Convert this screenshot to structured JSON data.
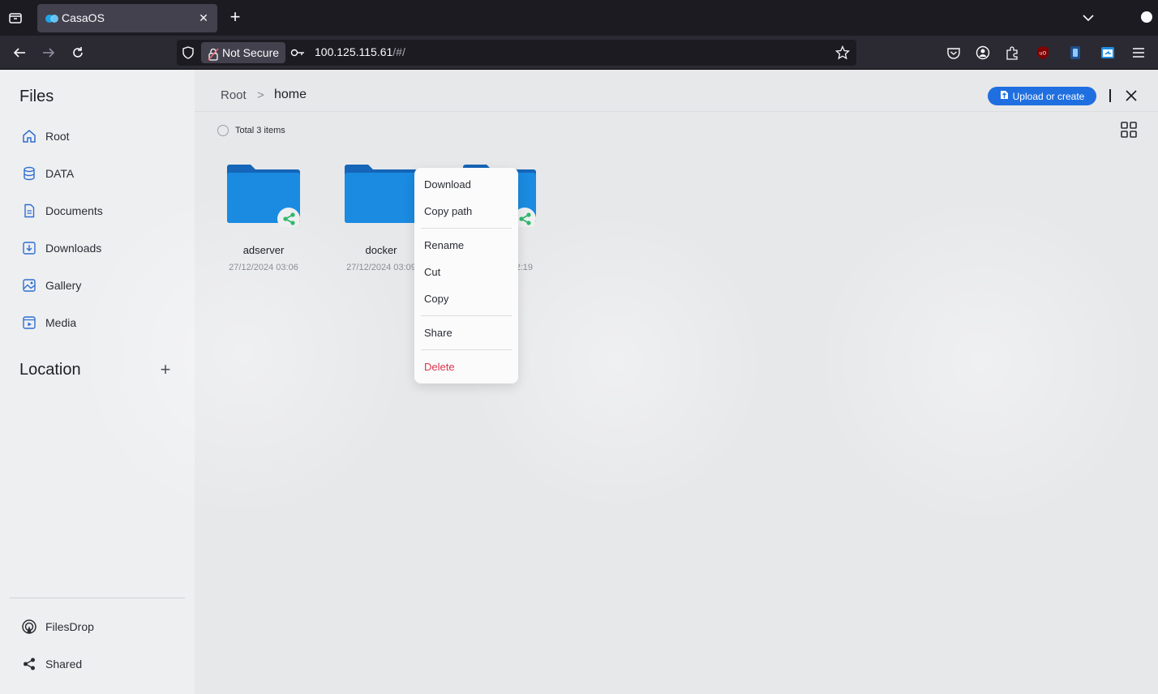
{
  "browser": {
    "tab_title": "CasaOS",
    "security_label": "Not Secure",
    "url_host": "100.125.115.61",
    "url_path": "/#/"
  },
  "sidebar": {
    "title": "Files",
    "items": [
      {
        "label": "Root",
        "icon": "home-icon"
      },
      {
        "label": "DATA",
        "icon": "database-icon"
      },
      {
        "label": "Documents",
        "icon": "document-icon"
      },
      {
        "label": "Downloads",
        "icon": "download-icon"
      },
      {
        "label": "Gallery",
        "icon": "image-icon"
      },
      {
        "label": "Media",
        "icon": "media-icon"
      }
    ],
    "location_title": "Location",
    "location_add": "+",
    "bottom_items": [
      {
        "label": "FilesDrop",
        "icon": "filesdrop-icon"
      },
      {
        "label": "Shared",
        "icon": "share-icon"
      }
    ]
  },
  "main": {
    "breadcrumb": [
      "Root",
      "home"
    ],
    "breadcrumb_sep": ">",
    "upload_label": "Upload or create",
    "total_label": "Total 3 items",
    "folders": [
      {
        "name": "adserver",
        "date": "27/12/2024 03:06",
        "shared": true
      },
      {
        "name": "docker",
        "date": "27/12/2024 03:09",
        "shared": false
      },
      {
        "name": "",
        "date": "2:19",
        "shared": true
      }
    ]
  },
  "context_menu": {
    "items": [
      {
        "label": "Download"
      },
      {
        "label": "Copy path"
      },
      {
        "label": "Rename"
      },
      {
        "label": "Cut"
      },
      {
        "label": "Copy"
      },
      {
        "label": "Share"
      },
      {
        "label": "Delete"
      }
    ]
  },
  "colors": {
    "accent": "#1f6fe0",
    "folder": "#1a7ad6",
    "share_badge": "#2fb86b",
    "danger": "#d9354c"
  }
}
